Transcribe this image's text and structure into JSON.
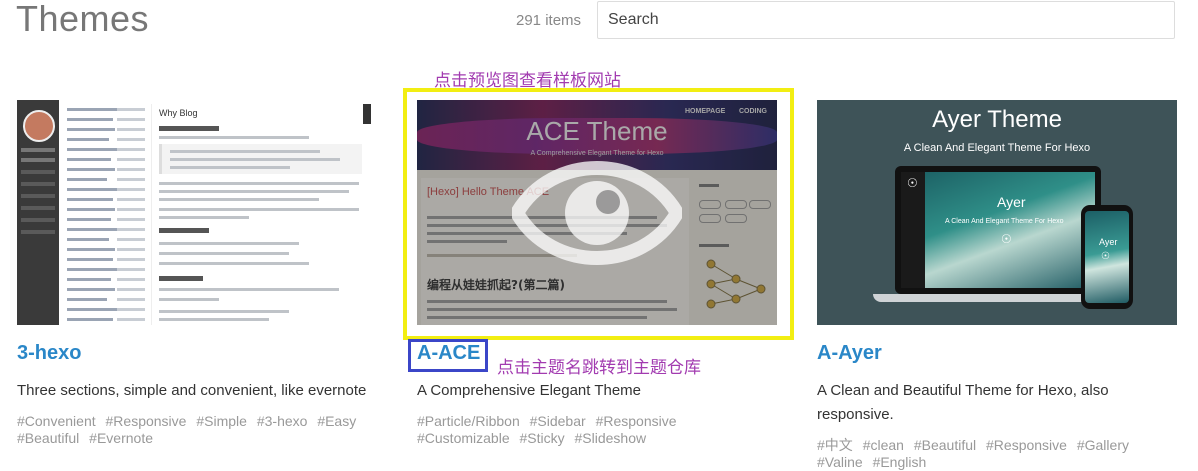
{
  "header": {
    "title": "Themes",
    "item_count": "291 items",
    "search_placeholder": "Search"
  },
  "annotations": {
    "preview_hint": "点击预览图查看样板网站",
    "name_hint": "点击主题名跳转到主题仓库"
  },
  "cards": [
    {
      "name": "3-hexo",
      "description": "Three sections, simple and convenient, like evernote",
      "tags": [
        "#Convenient",
        "#Responsive",
        "#Simple",
        "#3-hexo",
        "#Easy",
        "#Beautiful",
        "#Evernote"
      ],
      "thumb": {
        "blog_title": "Why Blog"
      }
    },
    {
      "name": "A-ACE",
      "description": "A Comprehensive Elegant Theme",
      "tags": [
        "#Particle/Ribbon",
        "#Sidebar",
        "#Responsive",
        "#Customizable",
        "#Sticky",
        "#Slideshow"
      ],
      "thumb": {
        "title": "ACE Theme",
        "subtitle": "A Comprehensive Elegant Theme for Hexo",
        "nav_home": "HOMEPAGE",
        "nav_coding": "CODING",
        "post_title": "[Hexo] Hello Theme ACE",
        "post_title2": "编程从娃娃抓起?(第二篇)"
      }
    },
    {
      "name": "A-Ayer",
      "description": "A Clean and Beautiful Theme for Hexo, also responsive.",
      "tags": [
        "#中文",
        "#clean",
        "#Beautiful",
        "#Responsive",
        "#Gallery",
        "#Valine",
        "#English"
      ],
      "thumb": {
        "title": "Ayer Theme",
        "subtitle": "A Clean And Elegant Theme For Hexo",
        "screen_title": "Ayer",
        "screen_sub": "A Clean And Elegant Theme For Hexo"
      }
    }
  ],
  "colors": {
    "link": "#2a87c8",
    "annotation": "#a23bb0",
    "highlight_yellow": "#f2ee12",
    "highlight_blue": "#3b46c8"
  },
  "icons": {
    "preview_overlay": "eye-icon"
  }
}
